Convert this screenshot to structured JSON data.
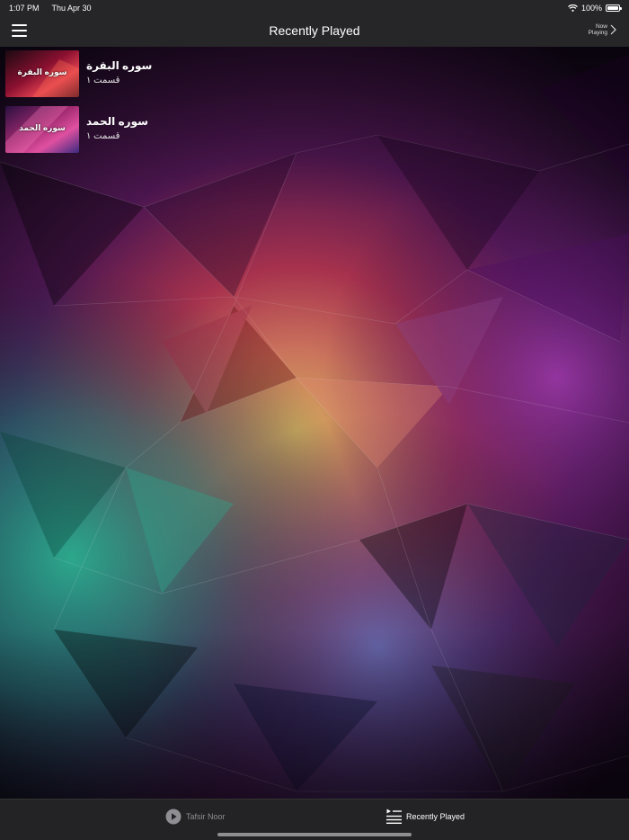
{
  "status_bar": {
    "time": "1:07 PM",
    "date": "Thu Apr 30",
    "battery": "100%",
    "battery_level": 1.0
  },
  "nav": {
    "title": "Recently Played",
    "now_playing_label": "Now Playing"
  },
  "items": [
    {
      "title": "سوره البقرة",
      "subtitle": "قسمت ۱",
      "thumb_text": "سوره البقرة"
    },
    {
      "title": "سوره الحمد",
      "subtitle": "قسمت ۱",
      "thumb_text": "سوره الحمد"
    }
  ],
  "tabs": [
    {
      "label": "Tafsir Noor",
      "icon": "play-circle-icon",
      "active": false
    },
    {
      "label": "Recently Played",
      "icon": "playlist-icon",
      "active": true
    }
  ],
  "colors": {
    "bar_background": "#262628",
    "active_tab": "#ffffff",
    "inactive_tab": "#8e8e93"
  }
}
